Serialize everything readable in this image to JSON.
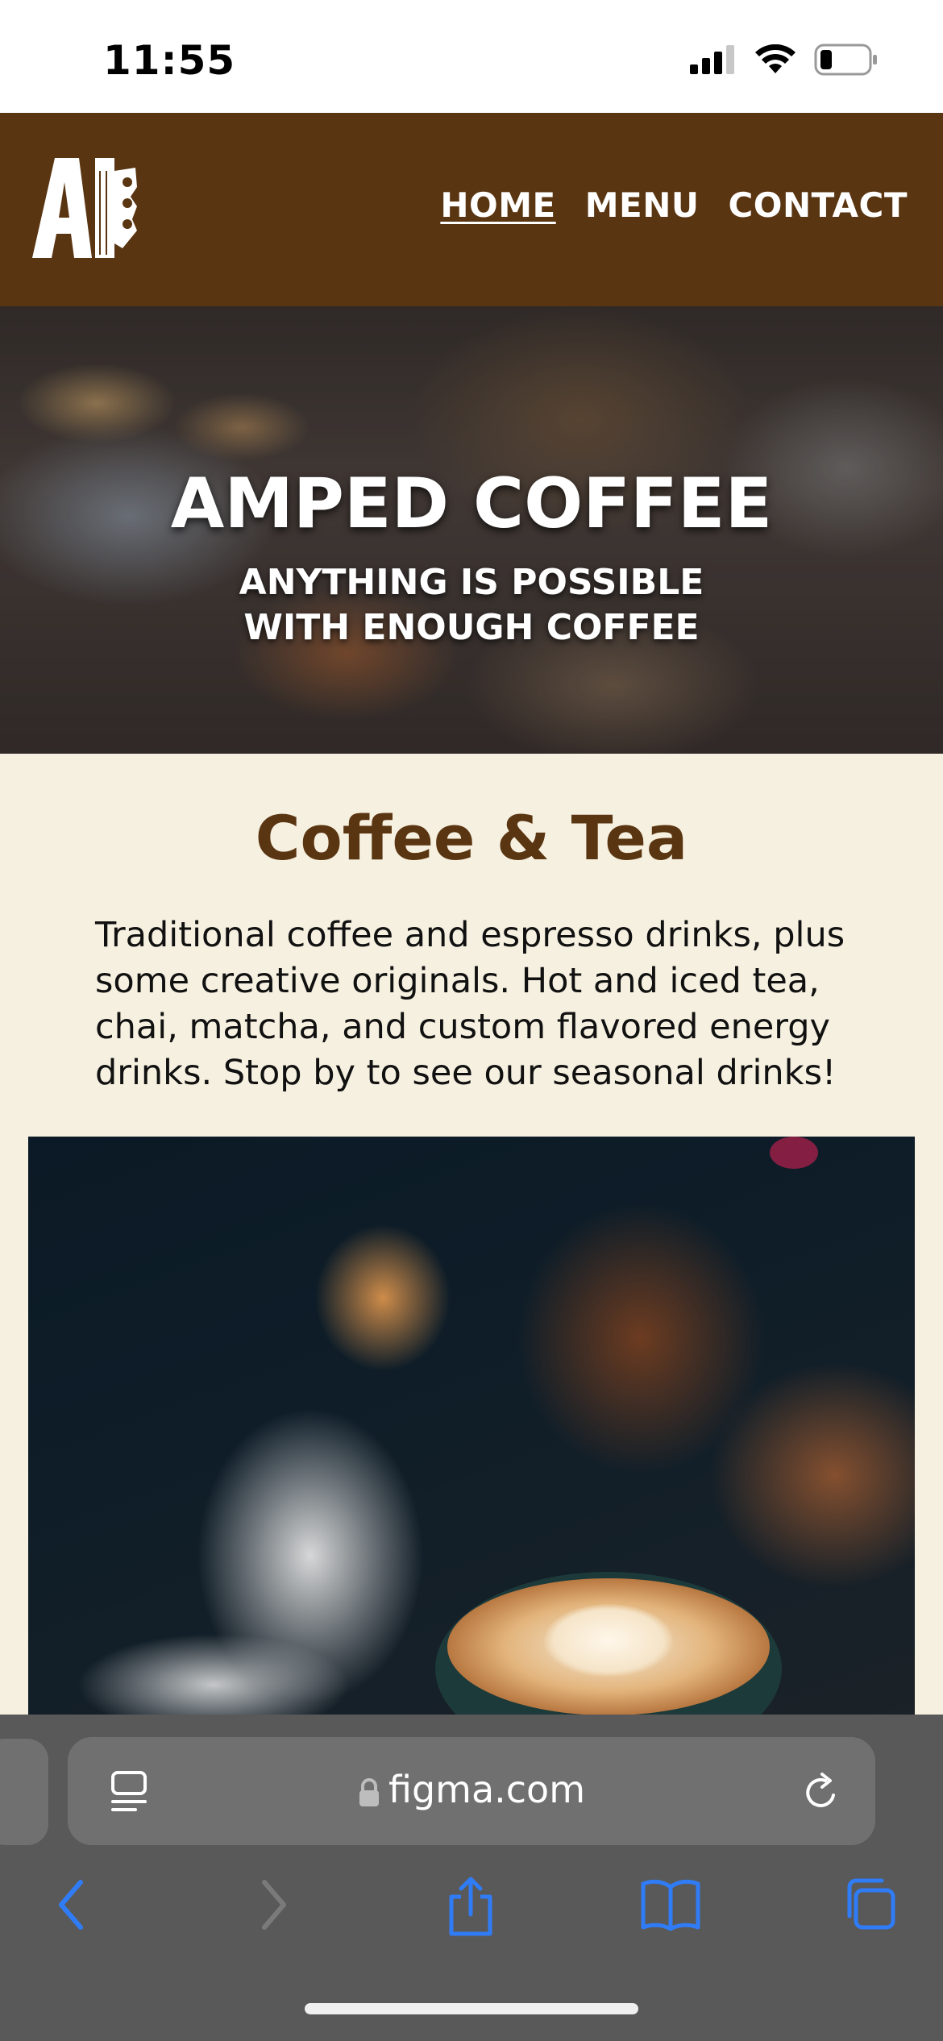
{
  "status_bar": {
    "time": "11:55"
  },
  "header": {
    "logo_alt": "AI",
    "nav": [
      {
        "label": "HOME",
        "active": true
      },
      {
        "label": "MENU",
        "active": false
      },
      {
        "label": "CONTACT",
        "active": false
      }
    ]
  },
  "hero": {
    "title": "AMPED COFFEE",
    "tagline_line1": "ANYTHING IS POSSIBLE",
    "tagline_line2": "WITH ENOUGH COFFEE"
  },
  "section": {
    "title": "Coffee & Tea",
    "body": "Traditional coffee and espresso drinks, plus some creative originals. Hot and iced tea, chai, matcha, and custom flavored energy drinks. Stop by to see our seasonal drinks!"
  },
  "browser": {
    "address": "figma.com",
    "icons": [
      "reader-icon",
      "lock-icon",
      "reload-icon",
      "back-icon",
      "forward-icon",
      "share-icon",
      "bookmarks-icon",
      "tabs-icon"
    ]
  },
  "colors": {
    "header_bg": "#5a3511",
    "page_bg": "#f6f0e0",
    "title_color": "#5a3511",
    "browser_bar": "#595959",
    "accent_blue": "#2f7cf6"
  }
}
